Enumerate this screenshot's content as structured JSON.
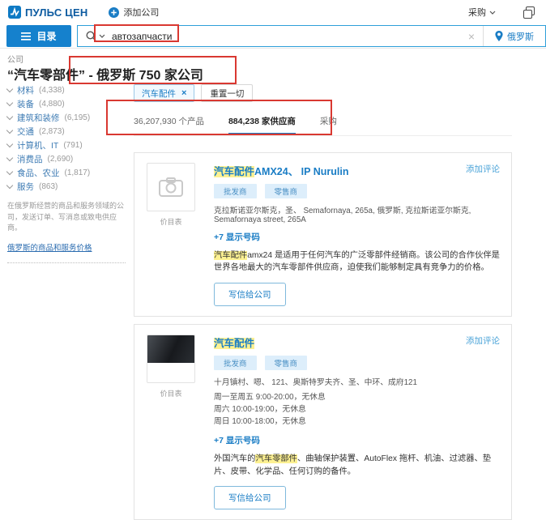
{
  "header": {
    "logo": "ПУЛЬС ЦЕН",
    "add_company": "添加公司",
    "procurement": "采购",
    "catalog": "目录",
    "search_value": "автозапчасти",
    "clear": "×",
    "location": "俄罗斯"
  },
  "breadcrumb": "公司",
  "title": {
    "query": "“汽车零部件”",
    "suffix": " - 俄罗斯 750 家公司"
  },
  "sidebar": {
    "categories": [
      {
        "label": "材料",
        "count": "(4,338)"
      },
      {
        "label": "装备",
        "count": "(4,880)"
      },
      {
        "label": "建筑和装修",
        "count": "(6,195)"
      },
      {
        "label": "交通",
        "count": "(2,873)"
      },
      {
        "label": "计算机、IT",
        "count": "(791)"
      },
      {
        "label": "消费品",
        "count": "(2,690)"
      },
      {
        "label": "食品、农业",
        "count": "(1,817)"
      },
      {
        "label": "服务",
        "count": "(863)"
      }
    ],
    "note": "在俄罗斯经营的商品和服务领域的公司，发送订单、写消息或致电供应商。",
    "price_link": "俄罗斯的商品和服务价格"
  },
  "filters": {
    "chip": "汽车配件",
    "chip_close": "×",
    "reset": "重置一切"
  },
  "tabs": [
    {
      "label": "36,207,930 个产品"
    },
    {
      "label": "884,238 家供应商"
    },
    {
      "label": "采购"
    }
  ],
  "listings": [
    {
      "title_hl": "汽车配件",
      "title": "AMX24、 IP Nurulin",
      "review": "添加评论",
      "badge1": "批发商",
      "badge2": "零售商",
      "address": "克拉斯诺亚尔斯克，圣、 Semafornaya, 265a, 俄罗斯, 克拉斯诺亚尔斯克, Semafornaya street, 265A",
      "phone": "+7 显示号码",
      "desc_pre": "",
      "desc_hl": "汽车配件",
      "desc": "amx24 是适用于任何汽车的广泛零部件经销商。该公司的合作伙伴是世界各地最大的汽车零部件供应商，迫使我们能够制定具有竞争力的价格。",
      "price_list": "价目表",
      "write": "写信给公司"
    },
    {
      "title_hl": "汽车配件",
      "title": "",
      "review": "添加评论",
      "badge1": "批发商",
      "badge2": "零售商",
      "address": "十月镇村、嗯、 121、奥斯特罗夫齐、圣、中环、成府121",
      "hours": [
        "周一至周五 9:00-20:00，无休息",
        "周六 10:00-19:00，无休息",
        "周日 10:00-18:00，无休息"
      ],
      "phone": "+7 显示号码",
      "desc_pre": "外国汽车的",
      "desc_hl": "汽车零部件",
      "desc": "、曲轴保护装置、AutoFlex 拖杆、机油、过滤器、垫片、皮带、化学品、任何订购的备件。",
      "price_list": "价目表",
      "write": "写信给公司"
    }
  ]
}
